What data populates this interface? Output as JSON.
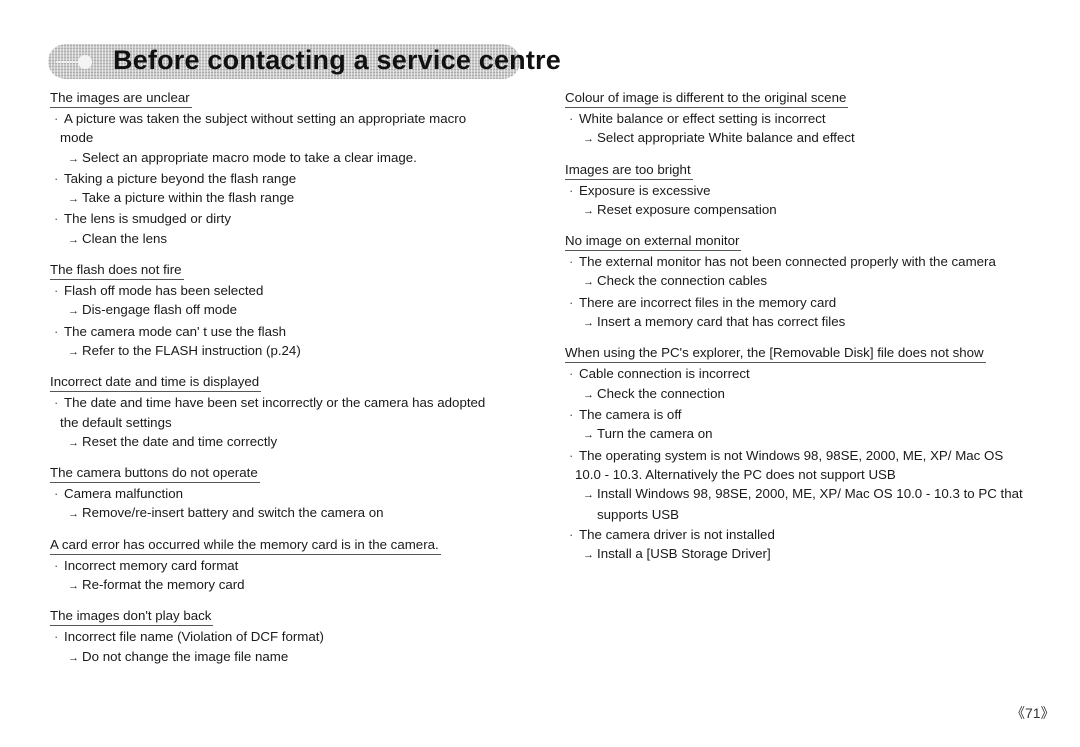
{
  "header": {
    "title": "Before contacting a service centre"
  },
  "icons": {
    "bullet": "·",
    "arrow": "→"
  },
  "left_column": [
    {
      "heading": "The images are unclear",
      "causes": [
        {
          "cause": "A picture was taken the subject without setting an appropriate macro mode",
          "fix": "Select an appropriate macro mode to take a clear image."
        },
        {
          "cause": "Taking a picture beyond the flash range",
          "fix": "Take a picture within the flash range"
        },
        {
          "cause": "The lens is smudged or dirty",
          "fix": "Clean the lens"
        }
      ]
    },
    {
      "heading": "The flash does not fire",
      "causes": [
        {
          "cause": "Flash off mode has been selected",
          "fix": "Dis-engage flash off mode"
        },
        {
          "cause": "The camera mode can' t use the flash",
          "fix": "Refer to the FLASH instruction (p.24)"
        }
      ]
    },
    {
      "heading": "Incorrect date and time is displayed",
      "causes": [
        {
          "cause": "The date and time have been set incorrectly or the camera has adopted the default settings",
          "fix": "Reset the date and time correctly"
        }
      ]
    },
    {
      "heading": "The camera buttons do not operate",
      "causes": [
        {
          "cause": "Camera malfunction",
          "fix": "Remove/re-insert battery and switch the camera on"
        }
      ]
    },
    {
      "heading": "A card error has occurred while the memory card is in the camera.",
      "causes": [
        {
          "cause": "Incorrect memory card format",
          "fix": "Re-format the memory card"
        }
      ]
    },
    {
      "heading": "The images don't play back",
      "causes": [
        {
          "cause": "Incorrect file name (Violation of DCF format)",
          "fix": "Do not change the image file name"
        }
      ]
    }
  ],
  "right_column": [
    {
      "heading": "Colour of image is different to the original scene",
      "causes": [
        {
          "cause": "White balance or effect setting is incorrect",
          "fix": "Select appropriate White balance and effect"
        }
      ]
    },
    {
      "heading": "Images are too bright",
      "causes": [
        {
          "cause": "Exposure is excessive",
          "fix": "Reset exposure compensation"
        }
      ]
    },
    {
      "heading": "No image on external monitor",
      "causes": [
        {
          "cause": "The external monitor has not been connected properly with the camera",
          "fix": "Check the connection cables"
        },
        {
          "cause": "There are incorrect files in the memory card",
          "fix": "Insert a memory card that has correct files"
        }
      ]
    },
    {
      "heading": "When using the PC's explorer, the [Removable Disk] file does not show",
      "causes": [
        {
          "cause": "Cable connection is incorrect",
          "fix": "Check the connection"
        },
        {
          "cause": "The camera is off",
          "fix": "Turn the camera on"
        },
        {
          "cause": "The operating system is not Windows 98, 98SE, 2000, ME, XP/ Mac OS 10.0 - 10.3. Alternatively the PC does not support USB",
          "fix": "Install Windows 98, 98SE, 2000, ME, XP/ Mac OS 10.0 - 10.3 to PC that supports USB"
        },
        {
          "cause": "The camera driver is not installed",
          "fix": "Install a [USB Storage Driver]"
        }
      ]
    }
  ],
  "footer": {
    "page_number": "《71》"
  }
}
